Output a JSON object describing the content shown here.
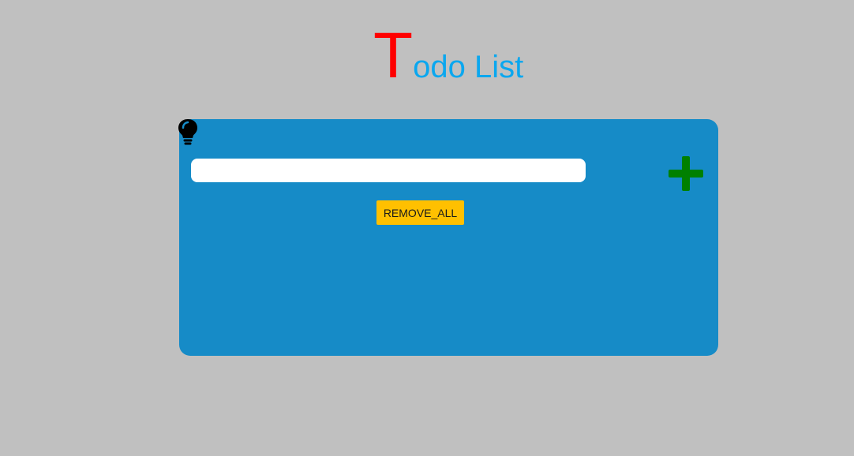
{
  "header": {
    "title_first_letter": "T",
    "title_rest": "odo List"
  },
  "todo": {
    "input_value": "",
    "input_placeholder": "",
    "remove_all_label": "REMOVE_ALL",
    "items": []
  },
  "icons": {
    "bulb": "lightbulb-icon",
    "add": "plus-icon"
  },
  "colors": {
    "background": "#c0c0c0",
    "title_first_letter": "#ff0000",
    "title_rest": "#0aa7ef",
    "card": "#168bc7",
    "add_icon": "#008000",
    "remove_button": "#ffc000"
  }
}
